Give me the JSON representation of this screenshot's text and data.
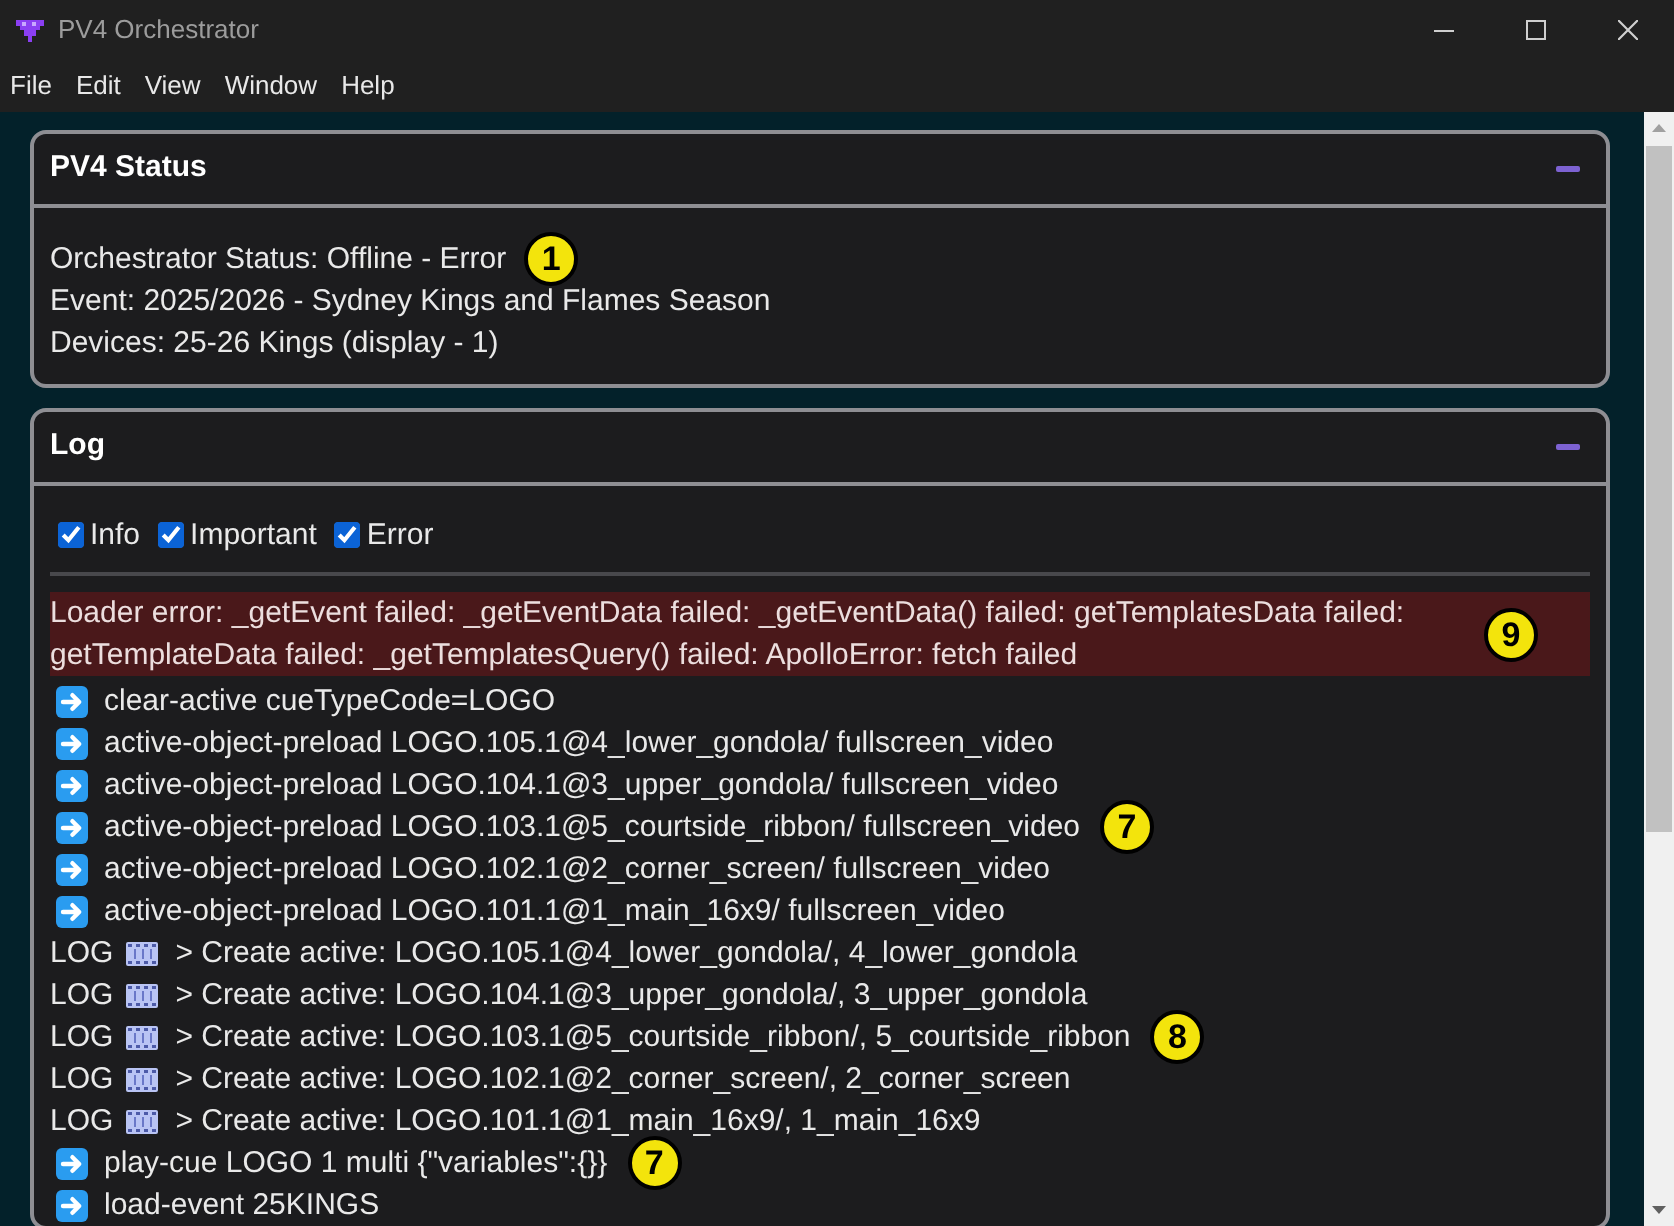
{
  "window": {
    "title": "PV4 Orchestrator"
  },
  "menu": [
    "File",
    "Edit",
    "View",
    "Window",
    "Help"
  ],
  "panels": [
    {
      "kind": "status",
      "title": "PV4 Status",
      "expanded": true,
      "lines": [
        {
          "text": "Orchestrator Status: Offline - Error",
          "callout": "1"
        },
        {
          "text": "Event: 2025/2026 - Sydney Kings and Flames Season"
        },
        {
          "text": "Devices: 25-26 Kings (display - 1)"
        }
      ]
    },
    {
      "kind": "log",
      "title": "Log",
      "expanded": true,
      "filters": [
        {
          "label": "Info",
          "checked": true
        },
        {
          "label": "Important",
          "checked": true
        },
        {
          "label": "Error",
          "checked": true
        }
      ],
      "entries": [
        {
          "kind": "error",
          "text": "Loader error: _getEvent failed: _getEventData failed: _getEventData() failed: getTemplatesData failed: getTemplateData failed: _getTemplatesQuery() failed: ApolloError: fetch failed",
          "callout": "9"
        },
        {
          "kind": "action",
          "text": "clear-active cueTypeCode=LOGO"
        },
        {
          "kind": "action",
          "text": "active-object-preload LOGO.105.1@4_lower_gondola/ fullscreen_video"
        },
        {
          "kind": "action",
          "text": "active-object-preload LOGO.104.1@3_upper_gondola/ fullscreen_video"
        },
        {
          "kind": "action",
          "text": "active-object-preload LOGO.103.1@5_courtside_ribbon/ fullscreen_video",
          "callout": "7"
        },
        {
          "kind": "action",
          "text": "active-object-preload LOGO.102.1@2_corner_screen/ fullscreen_video"
        },
        {
          "kind": "action",
          "text": "active-object-preload LOGO.101.1@1_main_16x9/ fullscreen_video"
        },
        {
          "kind": "log",
          "prefix": "LOG",
          "text": "> Create active: LOGO.105.1@4_lower_gondola/, 4_lower_gondola"
        },
        {
          "kind": "log",
          "prefix": "LOG",
          "text": "> Create active: LOGO.104.1@3_upper_gondola/, 3_upper_gondola"
        },
        {
          "kind": "log",
          "prefix": "LOG",
          "text": "> Create active: LOGO.103.1@5_courtside_ribbon/, 5_courtside_ribbon",
          "callout": "8"
        },
        {
          "kind": "log",
          "prefix": "LOG",
          "text": "> Create active: LOGO.102.1@2_corner_screen/, 2_corner_screen"
        },
        {
          "kind": "log",
          "prefix": "LOG",
          "text": "> Create active: LOGO.101.1@1_main_16x9/, 1_main_16x9"
        },
        {
          "kind": "action",
          "text": "play-cue LOGO 1 multi {\"variables\":{}}",
          "callout": "7"
        },
        {
          "kind": "action",
          "text": "load-event 25KINGS"
        }
      ]
    }
  ]
}
